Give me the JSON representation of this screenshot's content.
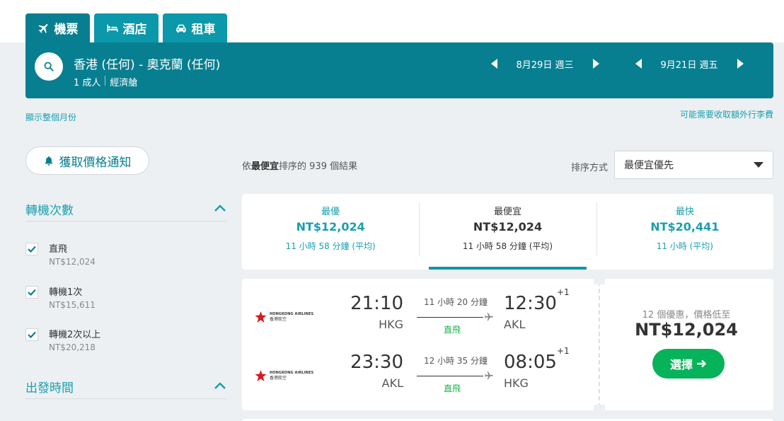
{
  "tabs": [
    {
      "label": "機票",
      "icon": "plane-icon"
    },
    {
      "label": "酒店",
      "icon": "bed-icon"
    },
    {
      "label": "租車",
      "icon": "car-icon"
    }
  ],
  "search": {
    "route": "香港 (任何) - 奧克蘭 (任何)",
    "passengers": "1 成人",
    "cabin": "經濟艙",
    "depart_date": "8月29日 週三",
    "return_date": "9月21日 週五"
  },
  "links": {
    "show_month": "顯示整個月份",
    "baggage": "可能需要收取額外行李費"
  },
  "price_alert": "獲取價格通知",
  "filters": {
    "stops": {
      "title": "轉機次數",
      "options": [
        {
          "label": "直飛",
          "price": "NT$12,024"
        },
        {
          "label": "轉機1次",
          "price": "NT$15,611"
        },
        {
          "label": "轉機2次以上",
          "price": "NT$20,218"
        }
      ]
    },
    "departure_time": {
      "title": "出發時間"
    }
  },
  "results": {
    "prefix": "依",
    "bold": "最便宜",
    "suffix": "排序的 939 個結果"
  },
  "sort": {
    "label": "排序方式",
    "selected": "最便宜優先"
  },
  "sort_tabs": [
    {
      "heading": "最優",
      "price": "NT$12,024",
      "duration": "11 小時 58 分鐘 (平均)"
    },
    {
      "heading": "最便宜",
      "price": "NT$12,024",
      "duration": "11 小時 58 分鐘 (平均)"
    },
    {
      "heading": "最快",
      "price": "NT$20,441",
      "duration": "11 小時 (平均)"
    }
  ],
  "flight_card": {
    "airline_en": "HONGKONG AIRLINES",
    "airline_zh": "香港航空",
    "legs": [
      {
        "dep_time": "21:10",
        "dep_code": "HKG",
        "duration": "11 小時 20 分鐘",
        "stops": "直飛",
        "arr_time": "12:30",
        "day_offset": "+1",
        "arr_code": "AKL"
      },
      {
        "dep_time": "23:30",
        "dep_code": "AKL",
        "duration": "12 小時 35 分鐘",
        "stops": "直飛",
        "arr_time": "08:05",
        "day_offset": "+1",
        "arr_code": "HKG"
      }
    ],
    "deals": "12 個優惠，價格低至",
    "price": "NT$12,024",
    "select_label": "選擇"
  },
  "colors": {
    "brand_teal": "#087f90",
    "accent_teal": "#1a9fb0",
    "select_green": "#07b35a",
    "direct_green": "#1ab24a"
  }
}
